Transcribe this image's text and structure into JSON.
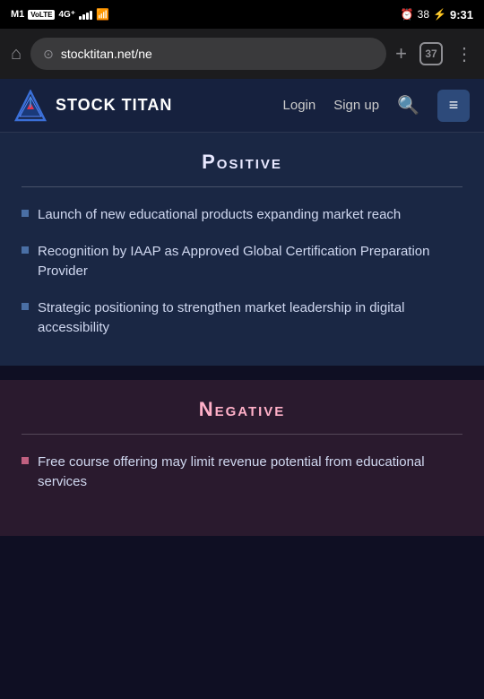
{
  "statusBar": {
    "carrier": "M1",
    "networkType": "VoLTE",
    "signal4g": "4G⁺",
    "alarm": "⏰",
    "battery": "38",
    "time": "9:31"
  },
  "browser": {
    "url": "stocktitan.net/ne",
    "tabsCount": "37",
    "newTabIcon": "+",
    "moreIcon": "⋮",
    "homeIcon": "⌂"
  },
  "nav": {
    "logoText": "STOCK TITAN",
    "loginLabel": "Login",
    "signupLabel": "Sign up"
  },
  "positive": {
    "title": "Positive",
    "items": [
      "Launch of new educational products expanding market reach",
      "Recognition by IAAP as Approved Global Certification Preparation Provider",
      "Strategic positioning to strengthen market leadership in digital accessibility"
    ]
  },
  "negative": {
    "title": "Negative",
    "items": [
      "Free course offering may limit revenue potential from educational services"
    ]
  }
}
